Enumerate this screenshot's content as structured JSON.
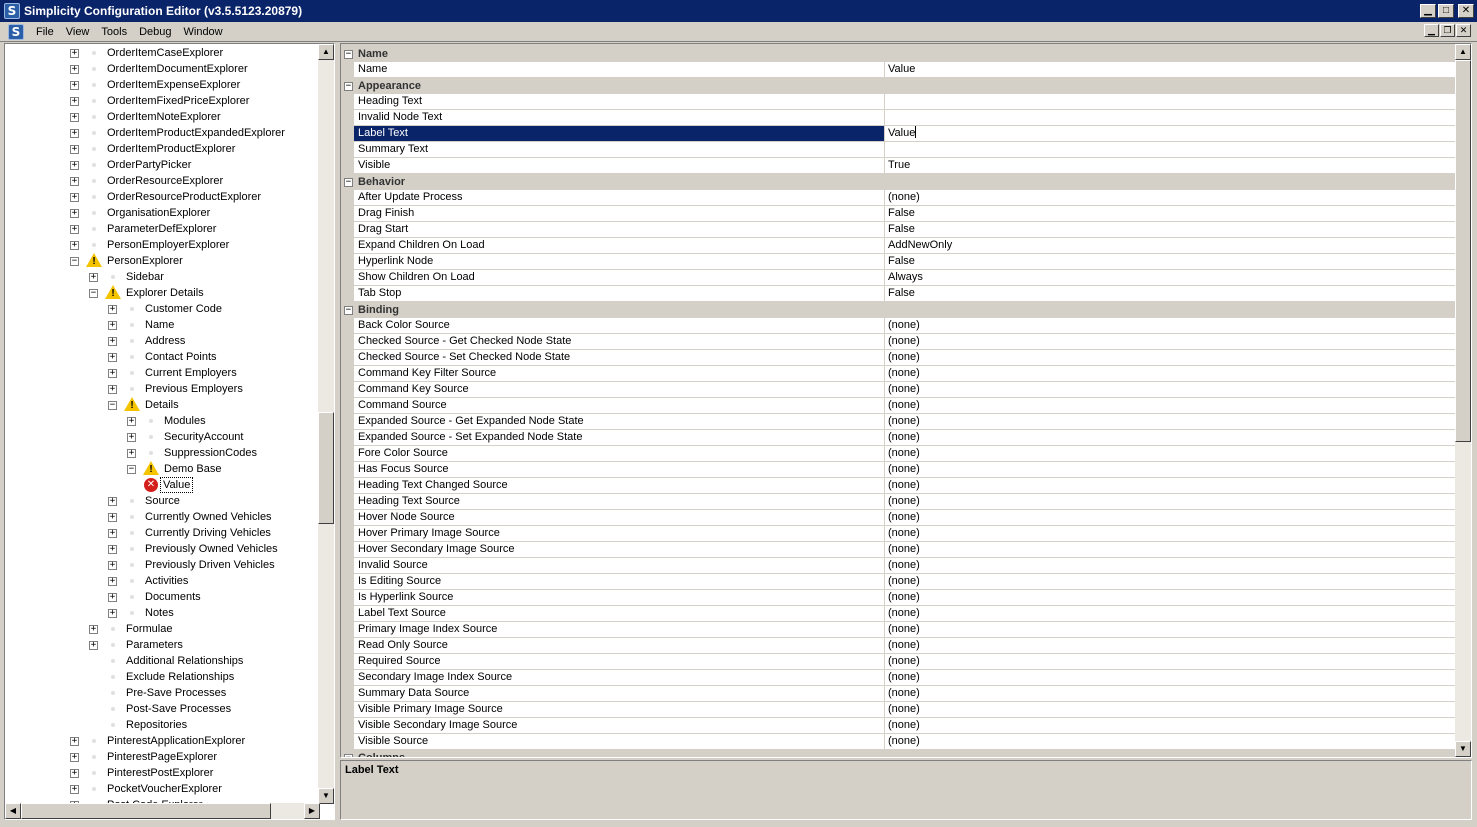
{
  "window": {
    "title": "Simplicity Configuration Editor (v3.5.5123.20879)",
    "app_icon_letter": "S",
    "minimize_glyph": "▁",
    "maximize_glyph": "□",
    "close_glyph": "✕",
    "restore_glyph": "❐"
  },
  "menu": {
    "items": [
      "File",
      "View",
      "Tools",
      "Debug",
      "Window"
    ]
  },
  "tree": {
    "items": [
      {
        "label": "OrderItemCaseExplorer",
        "level": 0,
        "expander": "+",
        "icon": "dot"
      },
      {
        "label": "OrderItemDocumentExplorer",
        "level": 0,
        "expander": "+",
        "icon": "dot"
      },
      {
        "label": "OrderItemExpenseExplorer",
        "level": 0,
        "expander": "+",
        "icon": "dot"
      },
      {
        "label": "OrderItemFixedPriceExplorer",
        "level": 0,
        "expander": "+",
        "icon": "dot"
      },
      {
        "label": "OrderItemNoteExplorer",
        "level": 0,
        "expander": "+",
        "icon": "dot"
      },
      {
        "label": "OrderItemProductExpandedExplorer",
        "level": 0,
        "expander": "+",
        "icon": "dot"
      },
      {
        "label": "OrderItemProductExplorer",
        "level": 0,
        "expander": "+",
        "icon": "dot"
      },
      {
        "label": "OrderPartyPicker",
        "level": 0,
        "expander": "+",
        "icon": "dot"
      },
      {
        "label": "OrderResourceExplorer",
        "level": 0,
        "expander": "+",
        "icon": "dot"
      },
      {
        "label": "OrderResourceProductExplorer",
        "level": 0,
        "expander": "+",
        "icon": "dot"
      },
      {
        "label": "OrganisationExplorer",
        "level": 0,
        "expander": "+",
        "icon": "dot"
      },
      {
        "label": "ParameterDefExplorer",
        "level": 0,
        "expander": "+",
        "icon": "dot"
      },
      {
        "label": "PersonEmployerExplorer",
        "level": 0,
        "expander": "+",
        "icon": "dot"
      },
      {
        "label": "PersonExplorer",
        "level": 0,
        "expander": "−",
        "icon": "warning"
      },
      {
        "label": "Sidebar",
        "level": 1,
        "expander": "+",
        "icon": "dot"
      },
      {
        "label": "Explorer Details",
        "level": 1,
        "expander": "−",
        "icon": "warning"
      },
      {
        "label": "Customer Code",
        "level": 2,
        "expander": "+",
        "icon": "dot"
      },
      {
        "label": "Name",
        "level": 2,
        "expander": "+",
        "icon": "dot"
      },
      {
        "label": "Address",
        "level": 2,
        "expander": "+",
        "icon": "dot"
      },
      {
        "label": "Contact Points",
        "level": 2,
        "expander": "+",
        "icon": "dot"
      },
      {
        "label": "Current Employers",
        "level": 2,
        "expander": "+",
        "icon": "dot"
      },
      {
        "label": "Previous Employers",
        "level": 2,
        "expander": "+",
        "icon": "dot"
      },
      {
        "label": "Details",
        "level": 2,
        "expander": "−",
        "icon": "warning"
      },
      {
        "label": "Modules",
        "level": 3,
        "expander": "+",
        "icon": "dot"
      },
      {
        "label": "SecurityAccount",
        "level": 3,
        "expander": "+",
        "icon": "dot"
      },
      {
        "label": "SuppressionCodes",
        "level": 3,
        "expander": "+",
        "icon": "dot"
      },
      {
        "label": "Demo Base",
        "level": 3,
        "expander": "−",
        "icon": "warning"
      },
      {
        "label": "Value",
        "level": 4,
        "expander": "",
        "icon": "error",
        "selected": true
      },
      {
        "label": "Source",
        "level": 2,
        "expander": "+",
        "icon": "dot"
      },
      {
        "label": "Currently Owned Vehicles",
        "level": 2,
        "expander": "+",
        "icon": "dot"
      },
      {
        "label": "Currently Driving Vehicles",
        "level": 2,
        "expander": "+",
        "icon": "dot"
      },
      {
        "label": "Previously Owned Vehicles",
        "level": 2,
        "expander": "+",
        "icon": "dot"
      },
      {
        "label": "Previously Driven Vehicles",
        "level": 2,
        "expander": "+",
        "icon": "dot"
      },
      {
        "label": "Activities",
        "level": 2,
        "expander": "+",
        "icon": "dot"
      },
      {
        "label": "Documents",
        "level": 2,
        "expander": "+",
        "icon": "dot"
      },
      {
        "label": "Notes",
        "level": 2,
        "expander": "+",
        "icon": "dot"
      },
      {
        "label": "Formulae",
        "level": 1,
        "expander": "+",
        "icon": "dot"
      },
      {
        "label": "Parameters",
        "level": 1,
        "expander": "+",
        "icon": "dot"
      },
      {
        "label": "Additional Relationships",
        "level": 1,
        "expander": "",
        "icon": "dot"
      },
      {
        "label": "Exclude Relationships",
        "level": 1,
        "expander": "",
        "icon": "dot"
      },
      {
        "label": "Pre-Save Processes",
        "level": 1,
        "expander": "",
        "icon": "dot"
      },
      {
        "label": "Post-Save Processes",
        "level": 1,
        "expander": "",
        "icon": "dot"
      },
      {
        "label": "Repositories",
        "level": 1,
        "expander": "",
        "icon": "dot"
      },
      {
        "label": "PinterestApplicationExplorer",
        "level": 0,
        "expander": "+",
        "icon": "dot"
      },
      {
        "label": "PinterestPageExplorer",
        "level": 0,
        "expander": "+",
        "icon": "dot"
      },
      {
        "label": "PinterestPostExplorer",
        "level": 0,
        "expander": "+",
        "icon": "dot"
      },
      {
        "label": "PocketVoucherExplorer",
        "level": 0,
        "expander": "+",
        "icon": "dot"
      },
      {
        "label": "Post Code Explorer",
        "level": 0,
        "expander": "+",
        "icon": "dot"
      }
    ],
    "warning_mark": "!",
    "error_mark": "✕"
  },
  "properties": {
    "rows": [
      {
        "type": "category",
        "label": "Name",
        "expander": "−"
      },
      {
        "type": "prop",
        "name": "Name",
        "value": "Value"
      },
      {
        "type": "category",
        "label": "Appearance",
        "expander": "−"
      },
      {
        "type": "prop",
        "name": "Heading Text",
        "value": ""
      },
      {
        "type": "prop",
        "name": "Invalid Node Text",
        "value": ""
      },
      {
        "type": "prop",
        "name": "Label Text",
        "value": "Value",
        "selected": true
      },
      {
        "type": "prop",
        "name": "Summary Text",
        "value": ""
      },
      {
        "type": "prop",
        "name": "Visible",
        "value": "True"
      },
      {
        "type": "category",
        "label": "Behavior",
        "expander": "−"
      },
      {
        "type": "prop",
        "name": "After Update Process",
        "value": "(none)"
      },
      {
        "type": "prop",
        "name": "Drag Finish",
        "value": "False"
      },
      {
        "type": "prop",
        "name": "Drag Start",
        "value": "False"
      },
      {
        "type": "prop",
        "name": "Expand Children On Load",
        "value": "AddNewOnly"
      },
      {
        "type": "prop",
        "name": "Hyperlink Node",
        "value": "False"
      },
      {
        "type": "prop",
        "name": "Show Children On Load",
        "value": "Always"
      },
      {
        "type": "prop",
        "name": "Tab Stop",
        "value": "False"
      },
      {
        "type": "category",
        "label": "Binding",
        "expander": "−"
      },
      {
        "type": "prop",
        "name": "Back Color Source",
        "value": "(none)"
      },
      {
        "type": "prop",
        "name": "Checked Source - Get Checked Node State",
        "value": "(none)"
      },
      {
        "type": "prop",
        "name": "Checked Source - Set Checked Node State",
        "value": "(none)"
      },
      {
        "type": "prop",
        "name": "Command Key Filter Source",
        "value": "(none)"
      },
      {
        "type": "prop",
        "name": "Command Key Source",
        "value": "(none)"
      },
      {
        "type": "prop",
        "name": "Command Source",
        "value": "(none)"
      },
      {
        "type": "prop",
        "name": "Expanded Source - Get Expanded Node State",
        "value": "(none)"
      },
      {
        "type": "prop",
        "name": "Expanded Source - Set Expanded Node State",
        "value": "(none)"
      },
      {
        "type": "prop",
        "name": "Fore Color Source",
        "value": "(none)"
      },
      {
        "type": "prop",
        "name": "Has Focus Source",
        "value": "(none)"
      },
      {
        "type": "prop",
        "name": "Heading Text Changed Source",
        "value": "(none)"
      },
      {
        "type": "prop",
        "name": "Heading Text Source",
        "value": "(none)"
      },
      {
        "type": "prop",
        "name": "Hover Node Source",
        "value": "(none)"
      },
      {
        "type": "prop",
        "name": "Hover Primary Image Source",
        "value": "(none)"
      },
      {
        "type": "prop",
        "name": "Hover Secondary Image Source",
        "value": "(none)"
      },
      {
        "type": "prop",
        "name": "Invalid Source",
        "value": "(none)"
      },
      {
        "type": "prop",
        "name": "Is Editing Source",
        "value": "(none)"
      },
      {
        "type": "prop",
        "name": "Is Hyperlink Source",
        "value": "(none)"
      },
      {
        "type": "prop",
        "name": "Label Text Source",
        "value": "(none)"
      },
      {
        "type": "prop",
        "name": "Primary Image Index Source",
        "value": "(none)"
      },
      {
        "type": "prop",
        "name": "Read Only Source",
        "value": "(none)"
      },
      {
        "type": "prop",
        "name": "Required Source",
        "value": "(none)"
      },
      {
        "type": "prop",
        "name": "Secondary Image Index Source",
        "value": "(none)"
      },
      {
        "type": "prop",
        "name": "Summary Data Source",
        "value": "(none)"
      },
      {
        "type": "prop",
        "name": "Visible Primary Image Source",
        "value": "(none)"
      },
      {
        "type": "prop",
        "name": "Visible Secondary Image Source",
        "value": "(none)"
      },
      {
        "type": "prop",
        "name": "Visible Source",
        "value": "(none)"
      },
      {
        "type": "category",
        "label": "Columns",
        "expander": "−"
      }
    ]
  },
  "help": {
    "title": "Label Text"
  },
  "scroll": {
    "up": "▲",
    "down": "▼",
    "left": "◀",
    "right": "▶"
  },
  "colors": {
    "selection": "#0a246a",
    "warning": "#f5c400",
    "error": "#d4201c"
  }
}
